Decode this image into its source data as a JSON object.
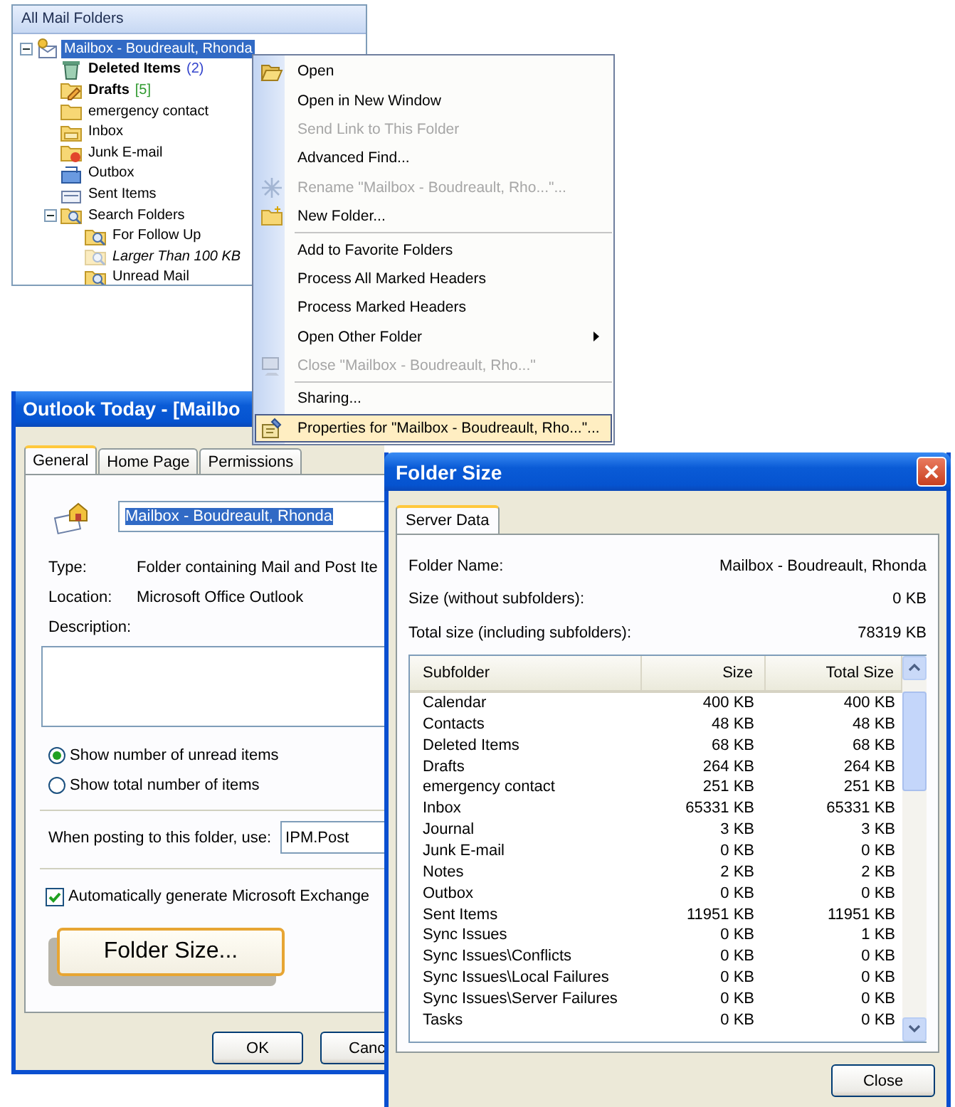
{
  "folder_pane": {
    "header": "All Mail Folders",
    "tree": [
      {
        "label": "Mailbox - Boudreault, Rhonda",
        "kind": "mailbox",
        "selected": true,
        "unread": false,
        "expanded": true,
        "children": [
          {
            "label": "Deleted Items",
            "count": "(2)",
            "color": "#3344cc",
            "kind": "trash",
            "selected": false,
            "unread": true
          },
          {
            "label": "Drafts",
            "count": "[5]",
            "color": "#2f9a2f",
            "kind": "drafts",
            "selected": false,
            "unread": true
          },
          {
            "label": "emergency contact",
            "kind": "folder",
            "selected": false,
            "unread": false
          },
          {
            "label": "Inbox",
            "kind": "inbox",
            "selected": false,
            "unread": false
          },
          {
            "label": "Junk E-mail",
            "kind": "junk",
            "selected": false,
            "unread": false
          },
          {
            "label": "Outbox",
            "kind": "outbox",
            "selected": false,
            "unread": false
          },
          {
            "label": "Sent Items",
            "kind": "sent",
            "selected": false,
            "unread": false
          },
          {
            "label": "Search Folders",
            "kind": "search",
            "selected": false,
            "unread": false,
            "expanded": true,
            "children": [
              {
                "label": "For Follow Up",
                "kind": "search",
                "selected": false,
                "unread": false,
                "empty": false
              },
              {
                "label": "Larger Than 100 KB",
                "kind": "search",
                "selected": false,
                "unread": false,
                "empty": true
              },
              {
                "label": "Unread Mail",
                "kind": "search",
                "selected": false,
                "unread": false,
                "empty": false
              }
            ]
          }
        ]
      }
    ]
  },
  "context_menu": {
    "items": [
      {
        "kind": "open",
        "label": "Open",
        "disabled": false,
        "selected": false,
        "submenu": false
      },
      {
        "kind": "item",
        "label": "Open in New Window",
        "disabled": false,
        "selected": false,
        "submenu": false
      },
      {
        "kind": "item",
        "label": "Send Link to This Folder",
        "disabled": true,
        "selected": false,
        "submenu": false
      },
      {
        "kind": "item",
        "label": "Advanced Find...",
        "disabled": false,
        "selected": false,
        "submenu": false
      },
      {
        "kind": "rename",
        "label": "Rename \"Mailbox - Boudreault, Rho...\"...",
        "disabled": true,
        "selected": false,
        "submenu": false
      },
      {
        "kind": "newfolder",
        "label": "New Folder...",
        "disabled": false,
        "selected": false,
        "submenu": false
      },
      {
        "kind": "separator"
      },
      {
        "kind": "item",
        "label": "Add to Favorite Folders",
        "disabled": false,
        "selected": false,
        "submenu": false
      },
      {
        "kind": "item",
        "label": "Process All Marked Headers",
        "disabled": false,
        "selected": false,
        "submenu": false
      },
      {
        "kind": "item",
        "label": "Process Marked Headers",
        "disabled": false,
        "selected": false,
        "submenu": false
      },
      {
        "kind": "item",
        "label": "Open Other Folder",
        "disabled": false,
        "selected": false,
        "submenu": true
      },
      {
        "kind": "close",
        "label": "Close \"Mailbox - Boudreault, Rho...\"",
        "disabled": true,
        "selected": false,
        "submenu": false
      },
      {
        "kind": "separator"
      },
      {
        "kind": "item",
        "label": "Sharing...",
        "disabled": false,
        "selected": false,
        "submenu": false
      },
      {
        "kind": "properties",
        "label": "Properties for \"Mailbox - Boudreault, Rho...\"...",
        "disabled": false,
        "selected": true,
        "submenu": false
      }
    ]
  },
  "properties_dialog": {
    "title": "Outlook Today - [Mailbo",
    "tabs": [
      {
        "label": "General",
        "selected": true
      },
      {
        "label": "Home Page",
        "selected": false
      },
      {
        "label": "Permissions",
        "selected": false
      }
    ],
    "name_field": {
      "value": "Mailbox - Boudreault, Rhonda",
      "text_selected": true
    },
    "details": [
      {
        "label": "Type:",
        "value": "Folder containing Mail and Post Ite"
      },
      {
        "label": "Location:",
        "value": "Microsoft Office Outlook"
      }
    ],
    "description_label": "Description:",
    "count_options": [
      {
        "label": "Show number of unread items",
        "selected": true
      },
      {
        "label": "Show total number of items",
        "selected": false
      }
    ],
    "posting_label": "When posting to this folder, use:",
    "posting_value": "IPM.Post",
    "auto_generate": {
      "label": "Automatically generate Microsoft Exchange",
      "checked": true
    },
    "folder_size_button": "Folder Size...",
    "buttons": [
      "OK",
      "Canc"
    ]
  },
  "folder_size_dialog": {
    "title": "Folder Size",
    "tabs": [
      {
        "label": "Server Data",
        "selected": true
      }
    ],
    "details": [
      {
        "label": "Folder Name:",
        "value": "Mailbox - Boudreault, Rhonda"
      },
      {
        "label": "Size (without subfolders):",
        "value": "0 KB"
      },
      {
        "label": "Total size (including subfolders):",
        "value": "78319 KB"
      }
    ],
    "table": {
      "columns": [
        "Subfolder",
        "Size",
        "Total Size"
      ],
      "rows": [
        [
          "Calendar",
          "400 KB",
          "400 KB"
        ],
        [
          "Contacts",
          "48 KB",
          "48 KB"
        ],
        [
          "Deleted Items",
          "68 KB",
          "68 KB"
        ],
        [
          "Drafts",
          "264 KB",
          "264 KB"
        ],
        [
          "emergency contact",
          "251 KB",
          "251 KB"
        ],
        [
          "Inbox",
          "65331 KB",
          "65331 KB"
        ],
        [
          "Journal",
          "3 KB",
          "3 KB"
        ],
        [
          "Junk E-mail",
          "0 KB",
          "0 KB"
        ],
        [
          "Notes",
          "2 KB",
          "2 KB"
        ],
        [
          "Outbox",
          "0 KB",
          "0 KB"
        ],
        [
          "Sent Items",
          "11951 KB",
          "11951 KB"
        ],
        [
          "Sync Issues",
          "0 KB",
          "1 KB"
        ],
        [
          "Sync Issues\\Conflicts",
          "0 KB",
          "0 KB"
        ],
        [
          "Sync Issues\\Local Failures",
          "0 KB",
          "0 KB"
        ],
        [
          "Sync Issues\\Server Failures",
          "0 KB",
          "0 KB"
        ],
        [
          "Tasks",
          "0 KB",
          "0 KB"
        ]
      ]
    },
    "close_button": "Close"
  }
}
